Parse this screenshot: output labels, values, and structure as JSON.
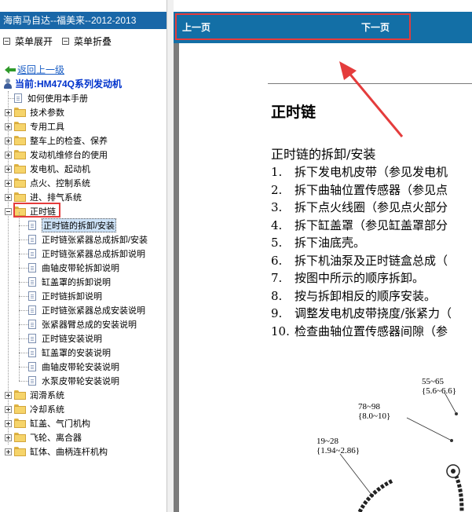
{
  "left_panel": {
    "title": "海南马自达--福美来--2012-2013",
    "toolbar": {
      "expand": "菜单展开",
      "collapse": "菜单折叠"
    },
    "back": "返回上一级",
    "current": "当前:HM474Q系列发动机",
    "tree": [
      {
        "label": "如何使用本手册",
        "type": "doc",
        "level": 0
      },
      {
        "label": "技术参数",
        "type": "folder",
        "level": 0
      },
      {
        "label": "专用工具",
        "type": "folder",
        "level": 0
      },
      {
        "label": "整车上的检查、保养",
        "type": "folder",
        "level": 0
      },
      {
        "label": "发动机维修台的使用",
        "type": "folder",
        "level": 0
      },
      {
        "label": "发电机、起动机",
        "type": "folder",
        "level": 0
      },
      {
        "label": "点火、控制系统",
        "type": "folder",
        "level": 0
      },
      {
        "label": "进、排气系统",
        "type": "folder",
        "level": 0
      },
      {
        "label": "正时链",
        "type": "folder-open",
        "level": 0
      },
      {
        "label": "正时链的拆卸/安装",
        "type": "doc",
        "level": 1,
        "selected": true
      },
      {
        "label": "正时链张紧器总成拆卸/安装",
        "type": "doc",
        "level": 1
      },
      {
        "label": "正时链张紧器总成拆卸说明",
        "type": "doc",
        "level": 1
      },
      {
        "label": "曲轴皮带轮拆卸说明",
        "type": "doc",
        "level": 1
      },
      {
        "label": "缸盖罩的拆卸说明",
        "type": "doc",
        "level": 1
      },
      {
        "label": "正时链拆卸说明",
        "type": "doc",
        "level": 1
      },
      {
        "label": "正时链张紧器总成安装说明",
        "type": "doc",
        "level": 1
      },
      {
        "label": "张紧器臂总成的安装说明",
        "type": "doc",
        "level": 1
      },
      {
        "label": "正时链安装说明",
        "type": "doc",
        "level": 1
      },
      {
        "label": "缸盖罩的安装说明",
        "type": "doc",
        "level": 1
      },
      {
        "label": "曲轴皮带轮安装说明",
        "type": "doc",
        "level": 1
      },
      {
        "label": "水泵皮带轮安装说明",
        "type": "doc",
        "level": 1
      },
      {
        "label": "润滑系统",
        "type": "folder",
        "level": 0
      },
      {
        "label": "冷却系统",
        "type": "folder",
        "level": 0
      },
      {
        "label": "缸盖、气门机构",
        "type": "folder",
        "level": 0
      },
      {
        "label": "飞轮、离合器",
        "type": "folder",
        "level": 0
      },
      {
        "label": "缸体、曲柄连杆机构",
        "type": "folder",
        "level": 0
      }
    ]
  },
  "nav": {
    "prev": "上一页",
    "next": "下一页"
  },
  "document": {
    "title": "正时链",
    "section": "正时链的拆卸/安装",
    "steps": [
      {
        "num": "1.",
        "text": "拆下发电机皮带（参见发电机"
      },
      {
        "num": "2.",
        "text": "拆下曲轴位置传感器（参见点"
      },
      {
        "num": "3.",
        "text": "拆下点火线圈（参见点火部分"
      },
      {
        "num": "4.",
        "text": "拆下缸盖罩（参见缸盖罩部分"
      },
      {
        "num": "5.",
        "text": "拆下油底壳。"
      },
      {
        "num": "6.",
        "text": "拆下机油泵及正时链盒总成（"
      },
      {
        "num": "7.",
        "text": "按图中所示的顺序拆卸。"
      },
      {
        "num": "8.",
        "text": "按与拆卸相反的顺序安装。"
      },
      {
        "num": "9.",
        "text": "调整发电机皮带挠度/张紧力（"
      },
      {
        "num": "10.",
        "text": "检查曲轴位置传感器间隙（参"
      }
    ],
    "torque_labels": [
      {
        "a": "55~65",
        "b": "{5.6~6.6}"
      },
      {
        "a": "78~98",
        "b": "{8.0~10}"
      },
      {
        "a": "19~28",
        "b": "{1.94~2.86}"
      }
    ]
  },
  "colors": {
    "title_bar": "#1967a8",
    "nav_bar": "#136fa6",
    "highlight": "#e43c3c"
  }
}
